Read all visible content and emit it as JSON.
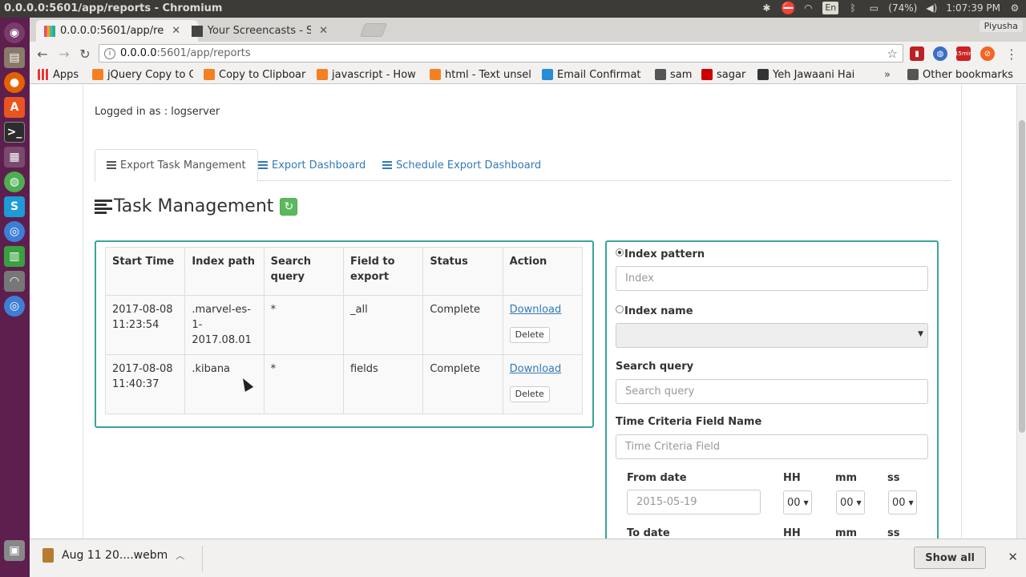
{
  "os": {
    "window_title": "0.0.0.0:5601/app/reports - Chromium",
    "lang": "En",
    "battery": "(74%)",
    "time": "1:07:39 PM"
  },
  "browser": {
    "tabs": [
      {
        "label": "0.0.0.0:5601/app/re",
        "active": true
      },
      {
        "label": "Your Screencasts - S",
        "active": false
      }
    ],
    "profile_name": "Piyusha",
    "url_host": "0.0.0.0",
    "url_rest": ":5601/app/reports",
    "ext_badge": "15min",
    "bookmarks": [
      {
        "label": "Apps"
      },
      {
        "label": "jQuery Copy to C"
      },
      {
        "label": "Copy to Clipboar"
      },
      {
        "label": "javascript - How"
      },
      {
        "label": "html - Text unsel"
      },
      {
        "label": "Email Confirmat"
      },
      {
        "label": "sam"
      },
      {
        "label": "sagar"
      },
      {
        "label": "Yeh Jawaani Hai"
      },
      {
        "label": "Other bookmarks"
      }
    ]
  },
  "app": {
    "logged_in": "Logged in as : logserver",
    "tabs": [
      {
        "label": "Export Task Mangement",
        "active": true
      },
      {
        "label": "Export Dashboard",
        "active": false
      },
      {
        "label": "Schedule Export Dashboard",
        "active": false
      }
    ],
    "heading": "Task Management",
    "table": {
      "headers": [
        "Start Time",
        "Index path",
        "Search query",
        "Field to export",
        "Status",
        "Action"
      ],
      "rows": [
        {
          "start": "2017-08-08 11:23:54",
          "index": ".marvel-es-1-2017.08.01",
          "query": "*",
          "field": "_all",
          "status": "Complete",
          "download": "Download",
          "delete": "Delete"
        },
        {
          "start": "2017-08-08 11:40:37",
          "index": ".kibana",
          "query": "*",
          "field": "fields",
          "status": "Complete",
          "download": "Download",
          "delete": "Delete"
        }
      ]
    },
    "form": {
      "index_pattern_label": "Index pattern",
      "index_placeholder": "Index",
      "index_name_label": "Index name",
      "search_query_label": "Search query",
      "search_query_placeholder": "Search query",
      "time_field_label": "Time Criteria Field Name",
      "time_field_placeholder": "Time Criteria Field",
      "from_date_label": "From date",
      "from_date_value": "2015-05-19",
      "to_date_label": "To date",
      "hh": "HH",
      "mm": "mm",
      "ss": "ss",
      "hh_value": "00",
      "mm_value": "00",
      "ss_value": "00"
    }
  },
  "downloads": {
    "file": "Aug 11 20....webm",
    "show_all": "Show all"
  }
}
